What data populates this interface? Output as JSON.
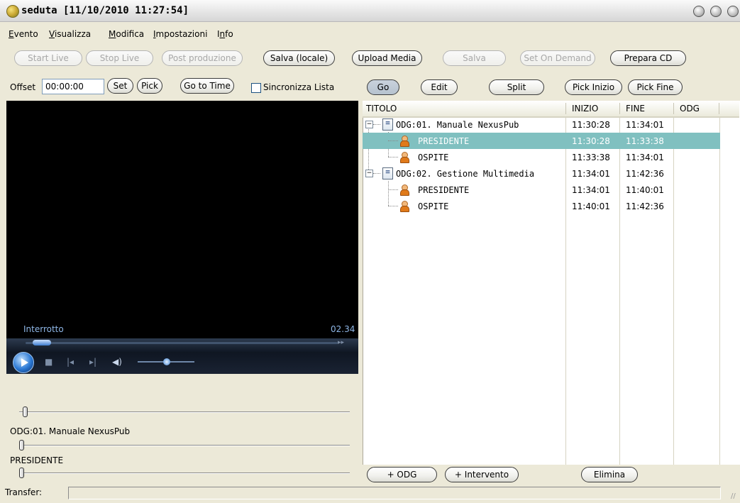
{
  "window": {
    "title": "seduta [11/10/2010 11:27:54]"
  },
  "menu": {
    "items": [
      {
        "label": "Evento",
        "u": "E"
      },
      {
        "label": "Visualizza",
        "u": "V"
      },
      {
        "label": "Modifica",
        "u": "M"
      },
      {
        "label": "Impostazioni",
        "u": "I"
      },
      {
        "label": "Info",
        "u": "n"
      }
    ]
  },
  "toolbar": {
    "start_live": "Start Live",
    "stop_live": "Stop Live",
    "post_produzione": "Post produzione",
    "salva_locale": "Salva (locale)",
    "upload_media": "Upload Media",
    "salva": "Salva",
    "set_on_demand": "Set On Demand",
    "prepara_cd": "Prepara CD"
  },
  "offset_row": {
    "label": "Offset",
    "value": "00:00:00",
    "set": "Set",
    "pick": "Pick",
    "go_to_time": "Go to Time",
    "sync_label": "Sincronizza Lista",
    "sync_checked": false,
    "go": "Go",
    "edit": "Edit",
    "split": "Split",
    "pick_inizio": "Pick Inizio",
    "pick_fine": "Pick Fine"
  },
  "player": {
    "status": "Interrotto",
    "time": "02.34"
  },
  "sliders": {
    "label1": "ODG:01. Manuale NexusPub",
    "label2": "PRESIDENTE"
  },
  "tree": {
    "columns": [
      "TITOLO",
      "INIZIO",
      "FINE",
      "ODG"
    ],
    "rows": [
      {
        "title": "ODG:01. Manuale NexusPub",
        "inizio": "11:30:28",
        "fine": "11:34:01",
        "level": 0,
        "selected": false
      },
      {
        "title": "PRESIDENTE",
        "inizio": "11:30:28",
        "fine": "11:33:38",
        "level": 1,
        "selected": true
      },
      {
        "title": "OSPITE",
        "inizio": "11:33:38",
        "fine": "11:34:01",
        "level": 1,
        "selected": false
      },
      {
        "title": "ODG:02. Gestione Multimedia",
        "inizio": "11:34:01",
        "fine": "11:42:36",
        "level": 0,
        "selected": false
      },
      {
        "title": "PRESIDENTE",
        "inizio": "11:34:01",
        "fine": "11:40:01",
        "level": 1,
        "selected": false
      },
      {
        "title": "OSPITE",
        "inizio": "11:40:01",
        "fine": "11:42:36",
        "level": 1,
        "selected": false
      }
    ]
  },
  "bottom_buttons": {
    "add_odg": "+ ODG",
    "add_intervento": "+ Intervento",
    "elimina": "Elimina"
  },
  "status_bar": {
    "label": "Transfer:",
    "value": ""
  },
  "colors": {
    "selection": "#80c0c0",
    "window_bg": "#ece9d8",
    "video_bg": "#000000"
  }
}
